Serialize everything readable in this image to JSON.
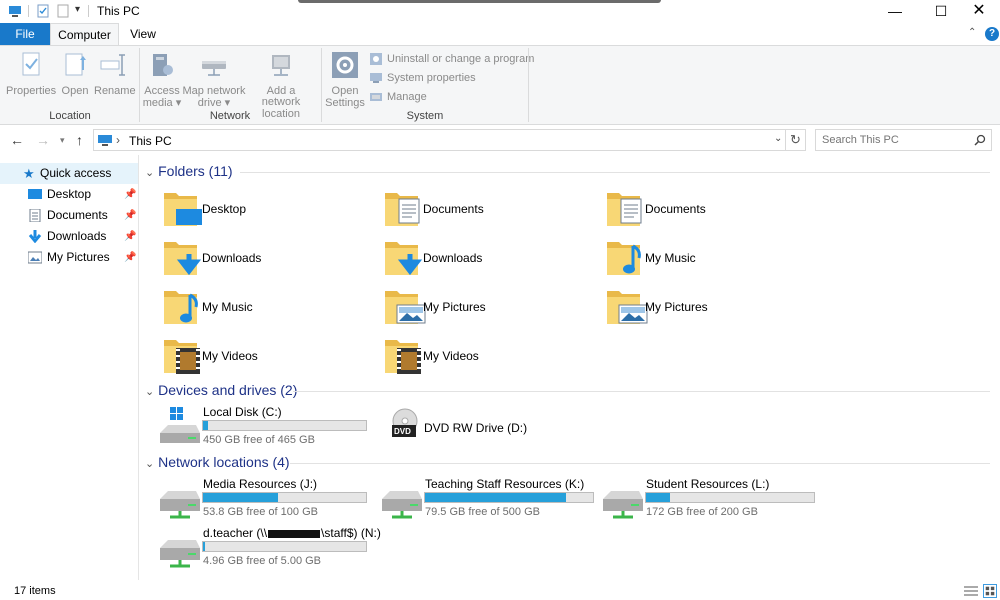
{
  "window": {
    "title": "This PC"
  },
  "ribbon": {
    "tabs": {
      "file": "File",
      "computer": "Computer",
      "view": "View"
    },
    "location": {
      "label": "Location",
      "properties": "Properties",
      "open": "Open",
      "rename": "Rename"
    },
    "network": {
      "label": "Network",
      "access_media_1": "Access",
      "access_media_2": "media",
      "map_drive_1": "Map network",
      "map_drive_2": "drive",
      "add_location_1": "Add a network",
      "add_location_2": "location"
    },
    "system": {
      "label": "System",
      "open_settings_1": "Open",
      "open_settings_2": "Settings",
      "uninstall": "Uninstall or change a program",
      "system_properties": "System properties",
      "manage": "Manage"
    }
  },
  "address": {
    "path": "This PC",
    "search_placeholder": "Search This PC"
  },
  "sidebar": {
    "quick_access": "Quick access",
    "items": [
      {
        "label": "Desktop"
      },
      {
        "label": "Documents"
      },
      {
        "label": "Downloads"
      },
      {
        "label": "My Pictures"
      }
    ]
  },
  "folders": {
    "header": "Folders (11)",
    "items": [
      {
        "label": "Desktop",
        "icon": "desktop-folder-icon"
      },
      {
        "label": "Documents",
        "icon": "documents-folder-icon"
      },
      {
        "label": "Documents",
        "icon": "documents-folder-icon"
      },
      {
        "label": "Downloads",
        "icon": "downloads-folder-icon"
      },
      {
        "label": "Downloads",
        "icon": "downloads-folder-icon"
      },
      {
        "label": "My Music",
        "icon": "music-folder-icon"
      },
      {
        "label": "My Music",
        "icon": "music-folder-icon"
      },
      {
        "label": "My Pictures",
        "icon": "pictures-folder-icon"
      },
      {
        "label": "My Pictures",
        "icon": "pictures-folder-icon"
      },
      {
        "label": "My Videos",
        "icon": "videos-folder-icon"
      },
      {
        "label": "My Videos",
        "icon": "videos-folder-icon"
      }
    ]
  },
  "devices": {
    "header": "Devices and drives (2)",
    "local_disk": {
      "label": "Local Disk (C:)",
      "free": "450 GB free of 465 GB",
      "used_fraction": 0.03
    },
    "dvd": {
      "label": "DVD RW Drive (D:)",
      "badge": "DVD"
    }
  },
  "network": {
    "header": "Network locations (4)",
    "items": [
      {
        "label": "Media Resources (J:)",
        "free": "53.8 GB free of 100 GB",
        "used_fraction": 0.46
      },
      {
        "label": "Teaching Staff Resources (K:)",
        "free": "79.5 GB free of 500 GB",
        "used_fraction": 0.84
      },
      {
        "label": "Student Resources (L:)",
        "free": "172 GB free of 200 GB",
        "used_fraction": 0.14
      },
      {
        "label": "d.teacher (\\\\",
        "label_suffix": "\\staff$) (N:)",
        "free": "4.96 GB free of 5.00 GB",
        "used_fraction": 0.01
      }
    ]
  },
  "status": {
    "items": "17 items"
  },
  "colors": {
    "accent": "#1979ca",
    "bar": "#26a0da",
    "header": "#1e3287",
    "folder": "#f8d775"
  }
}
